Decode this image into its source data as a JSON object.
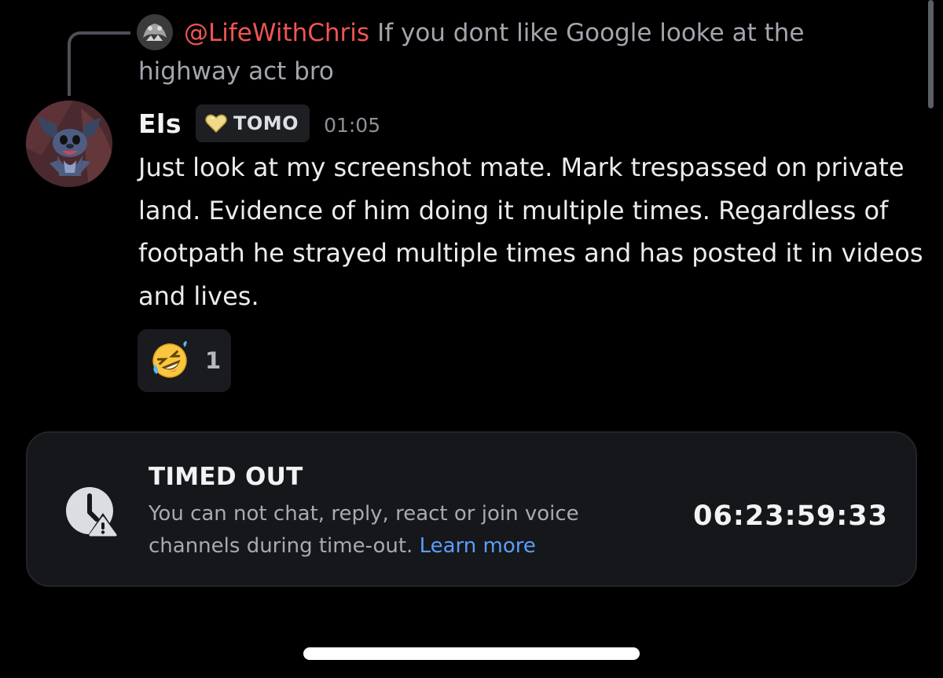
{
  "reply": {
    "mention": "@LifeWithChris",
    "text": "If you dont like Google looke at the highway act bro",
    "avatar_icon": "reply-user-avatar"
  },
  "message": {
    "author": "Els",
    "tag_label": "TOMO",
    "tag_icon": "heart-icon",
    "timestamp": "01:05",
    "body": "Just look at my screenshot mate. Mark trespassed on private land. Evidence of him doing it multiple times. Regardless of footpath he strayed multiple times and has posted it in videos and lives.",
    "reaction": {
      "emoji": "rolling-on-floor-laughing",
      "count": "1"
    }
  },
  "timeout": {
    "title": "TIMED OUT",
    "description": "You can not chat, reply, react or join voice channels during time-out.",
    "link_label": "Learn more",
    "countdown": "06:23:59:33",
    "icon": "clock-warning-icon"
  },
  "colors": {
    "background": "#000000",
    "mention": "#f0554f",
    "link": "#5b9df8",
    "card": "#16171a"
  }
}
